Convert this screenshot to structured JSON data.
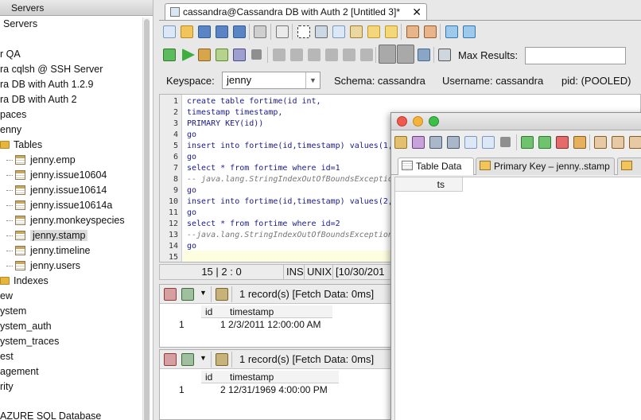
{
  "tree": {
    "header": "Servers",
    "items": [
      {
        "label": "Servers",
        "kind": "text"
      },
      {
        "label": "r QA",
        "kind": "text"
      },
      {
        "label": "ra cqlsh @ SSH Server",
        "kind": "text"
      },
      {
        "label": "ra DB with Auth 1.2.9",
        "kind": "text"
      },
      {
        "label": "ra DB with Auth 2",
        "kind": "text"
      },
      {
        "label": "paces",
        "kind": "text"
      },
      {
        "label": "enny",
        "kind": "text"
      },
      {
        "label": "Tables",
        "kind": "folder"
      },
      {
        "label": "jenny.emp",
        "kind": "table"
      },
      {
        "label": "jenny.issue10604",
        "kind": "table"
      },
      {
        "label": "jenny.issue10614",
        "kind": "table"
      },
      {
        "label": "jenny.issue10614a",
        "kind": "table"
      },
      {
        "label": "jenny.monkeyspecies",
        "kind": "table"
      },
      {
        "label": "jenny.stamp",
        "kind": "table",
        "selected": true
      },
      {
        "label": "jenny.timeline",
        "kind": "table"
      },
      {
        "label": "jenny.users",
        "kind": "table"
      },
      {
        "label": "Indexes",
        "kind": "folder"
      },
      {
        "label": "ew",
        "kind": "text"
      },
      {
        "label": "ystem",
        "kind": "text"
      },
      {
        "label": "ystem_auth",
        "kind": "text"
      },
      {
        "label": "ystem_traces",
        "kind": "text"
      },
      {
        "label": "est",
        "kind": "text"
      },
      {
        "label": "agement",
        "kind": "text"
      },
      {
        "label": "rity",
        "kind": "text"
      },
      {
        "label": "AZURE SQL Database",
        "kind": "text"
      }
    ]
  },
  "editor_tab": {
    "title": "cassandra@Cassandra DB with Auth 2 [Untitled 3]*",
    "close": "✕"
  },
  "toolbar": {
    "max_results_label": "Max Results:",
    "max_results_value": ""
  },
  "connection": {
    "keyspace_label": "Keyspace:",
    "keyspace_value": "jenny",
    "schema": "Schema:  cassandra",
    "username": "Username:  cassandra",
    "pid": "pid:  (POOLED)"
  },
  "code_lines": [
    "create table fortime(id int,",
    "timestamp timestamp,",
    "PRIMARY KEY(id))",
    "go",
    "insert into fortime(id,timestamp) values(1,",
    "go",
    "select * from fortime where id=1",
    "-- java.lang.StringIndexOutOfBoundsExceptio",
    "go",
    "insert into fortime(id,timestamp) values(2,",
    "go",
    "select * from fortime where id=2",
    "--java.lang.StringIndexOutOfBoundsException",
    "go",
    ""
  ],
  "status_bar": {
    "position": "15 | 2 : 0",
    "mode": "INS",
    "line_ending": "UNIX",
    "date_fragment": "[10/30/201"
  },
  "results": [
    {
      "message": "1 record(s) [Fetch Data: 0ms]",
      "columns": [
        "id",
        "timestamp"
      ],
      "row_num": "1",
      "row": [
        "1",
        "2/3/2011 12:00:00 AM"
      ]
    },
    {
      "message": "1 record(s) [Fetch Data: 0ms]",
      "columns": [
        "id",
        "timestamp"
      ],
      "row_num": "1",
      "row": [
        "2",
        "12/31/1969 4:00:00 PM"
      ]
    }
  ],
  "float_window": {
    "tabs": [
      {
        "label": "Table Data",
        "active": true
      },
      {
        "label": "Primary Key – jenny..stamp",
        "active": false
      }
    ],
    "column": "ts"
  },
  "colors": {
    "close_light": "#ee5a4f",
    "min_light": "#f3b43d",
    "max_light": "#3fbe4a",
    "selection": "#dcdcdc"
  }
}
